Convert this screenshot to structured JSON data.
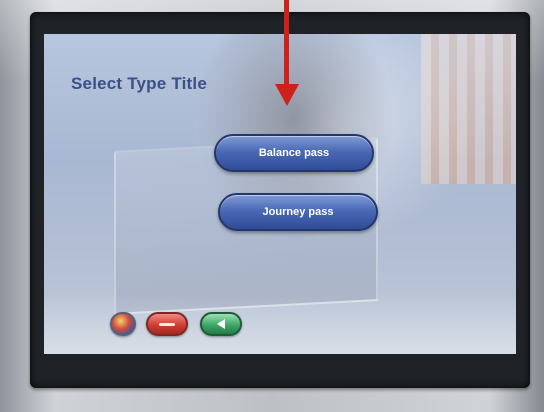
{
  "screen": {
    "title": "Select Type Title",
    "options": [
      {
        "label": "Balance pass"
      },
      {
        "label": "Journey pass"
      }
    ]
  },
  "footer": {
    "language_icon": "flag-globe-icon",
    "cancel_icon": "minus-icon",
    "back_icon": "back-arrow-icon"
  },
  "annotation": {
    "arrow_color": "#d0201a"
  },
  "colors": {
    "button_blue": "#4a69b5",
    "cancel_red": "#d23d33",
    "back_green": "#3ea866",
    "title_color": "#3c4f86"
  }
}
